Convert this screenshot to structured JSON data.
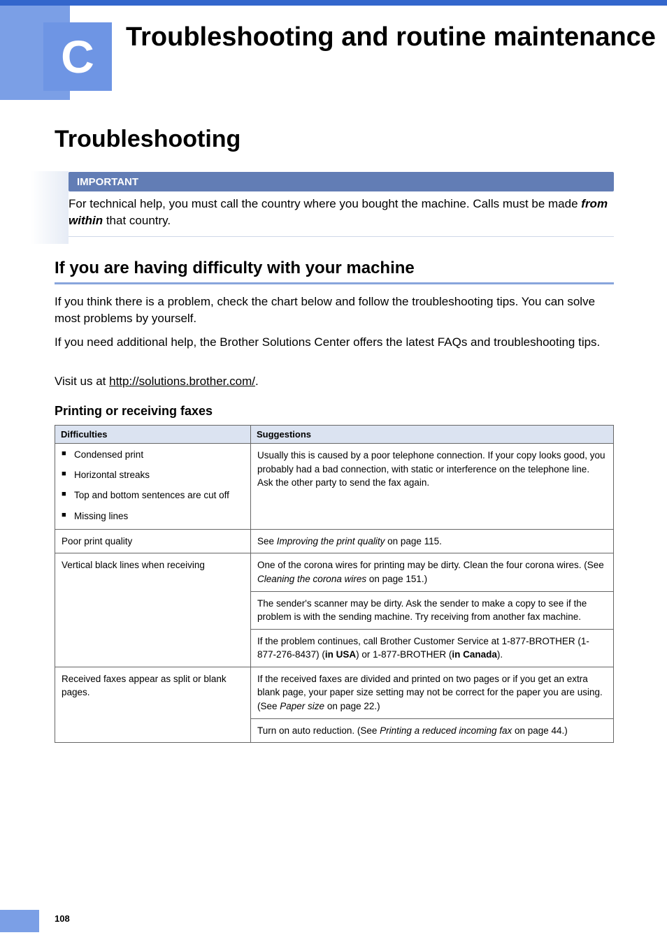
{
  "chapter": {
    "letter": "C",
    "title": "Troubleshooting and routine maintenance"
  },
  "h1": "Troubleshooting",
  "important": {
    "label": "IMPORTANT",
    "text_before": "For technical help, you must call the country where you bought the machine. Calls must be made ",
    "text_em": "from within",
    "text_after": " that country."
  },
  "subheading": "If you are having difficulty with your machine",
  "paragraphs": {
    "p1": "If you think there is a problem, check the chart below and follow the troubleshooting tips. You can solve most problems by yourself.",
    "p2": "If you need additional help, the Brother Solutions Center offers the latest FAQs and troubleshooting tips.",
    "p3_before": "Visit us at ",
    "p3_link": "http://solutions.brother.com/",
    "p3_after": "."
  },
  "table_heading": "Printing or receiving faxes",
  "table": {
    "header": {
      "col1": "Difficulties",
      "col2": "Suggestions"
    },
    "row1": {
      "li1": "Condensed print",
      "li2": "Horizontal streaks",
      "li3": "Top and bottom sentences are cut off",
      "li4": "Missing lines",
      "suggestion": "Usually this is caused by a poor telephone connection. If your copy looks good, you probably had a bad connection, with static or interference on the telephone line. Ask the other party to send the fax again."
    },
    "row2": {
      "difficulty": "Poor print quality",
      "suggestion_before": "See ",
      "suggestion_em": "Improving the print quality",
      "suggestion_after": " on page 115."
    },
    "row3": {
      "difficulty": "Vertical black lines when receiving",
      "s1_before": "One of the corona wires for printing may be dirty. Clean the four corona wires. (See ",
      "s1_em": "Cleaning the corona wires",
      "s1_after": " on page 151.)",
      "s2": "The sender's scanner may be dirty. Ask the sender to make a copy to see if the problem is with the sending machine. Try receiving from another fax machine.",
      "s3_a": "If the problem continues, call Brother Customer Service at 1-877-BROTHER (1-877-276-8437) (",
      "s3_b": "in USA",
      "s3_c": ") or 1-877-BROTHER (",
      "s3_d": "in Canada",
      "s3_e": ")."
    },
    "row4": {
      "difficulty": "Received faxes appear as split or blank pages.",
      "s1_before": "If the received faxes are divided and printed on two pages or if you get an extra blank page, your paper size setting may not be correct for the paper you are using. (See ",
      "s1_em": "Paper size",
      "s1_after": " on page 22.)",
      "s2_before": "Turn on auto reduction. (See ",
      "s2_em": "Printing a reduced incoming fax",
      "s2_after": " on page 44.)"
    }
  },
  "page_number": "108"
}
